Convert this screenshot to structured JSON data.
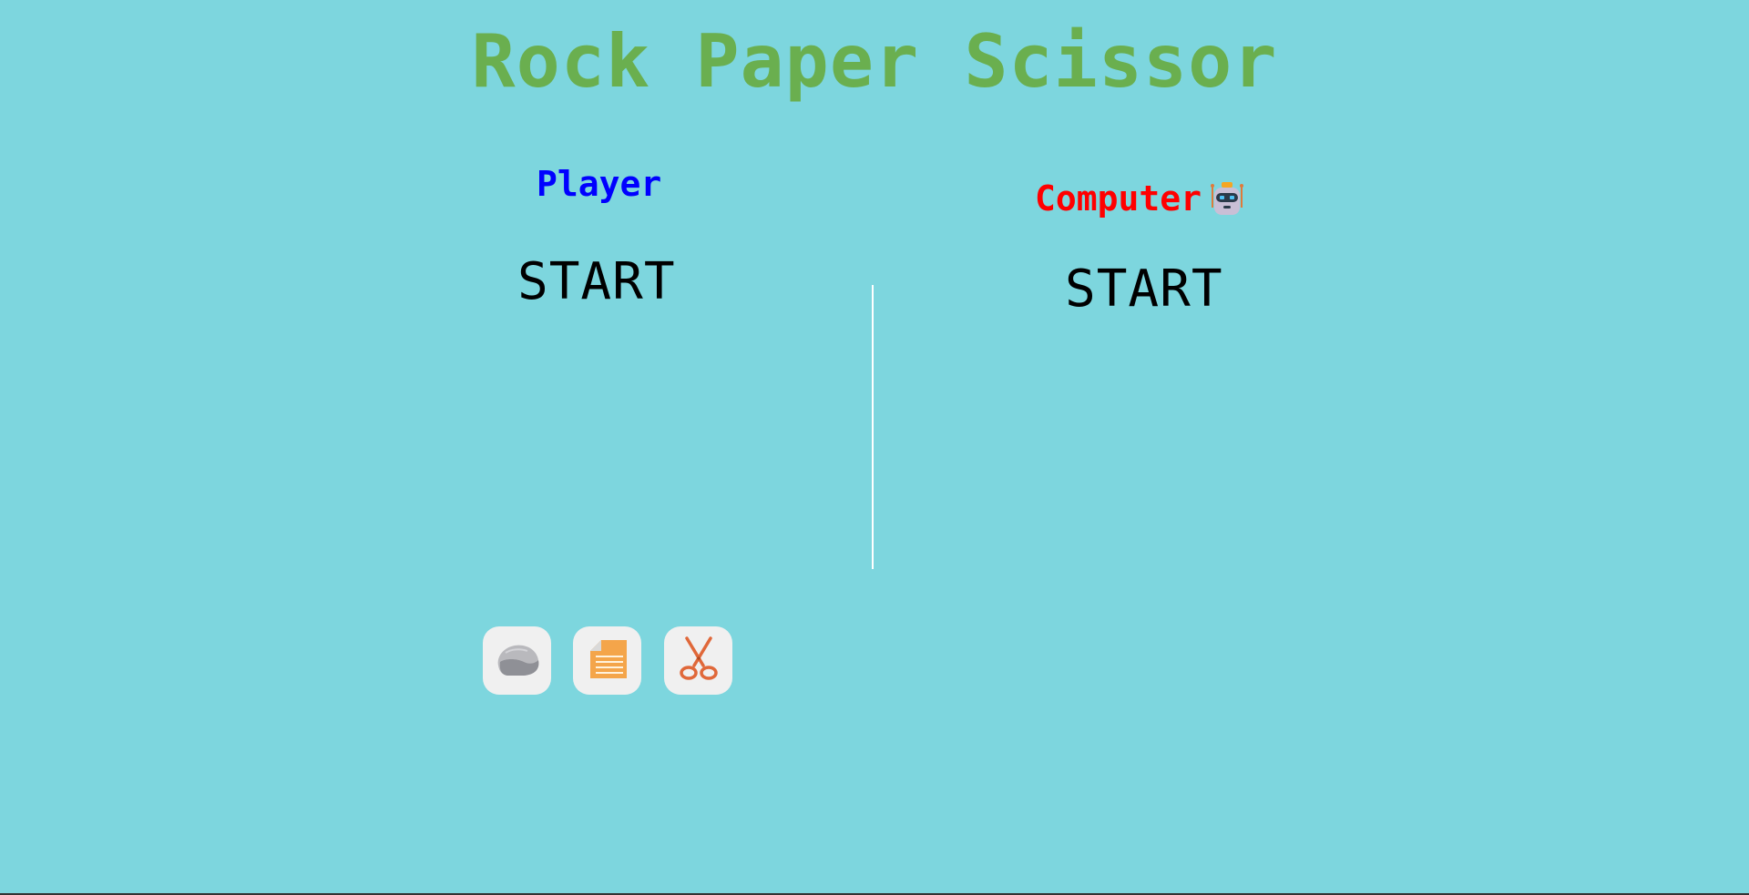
{
  "title": "Rock Paper Scissor",
  "player": {
    "label": "Player",
    "status": "START"
  },
  "computer": {
    "label": "Computer",
    "icon": "robot-icon",
    "status": "START"
  },
  "choices": [
    {
      "name": "rock",
      "icon": "rock-icon"
    },
    {
      "name": "paper",
      "icon": "paper-icon"
    },
    {
      "name": "scissor",
      "icon": "scissors-icon"
    }
  ],
  "colors": {
    "background": "#7dd6de",
    "title": "#6aaf4f",
    "player": "#0000ff",
    "computer": "#ff0000",
    "button": "#f0f0f0"
  }
}
